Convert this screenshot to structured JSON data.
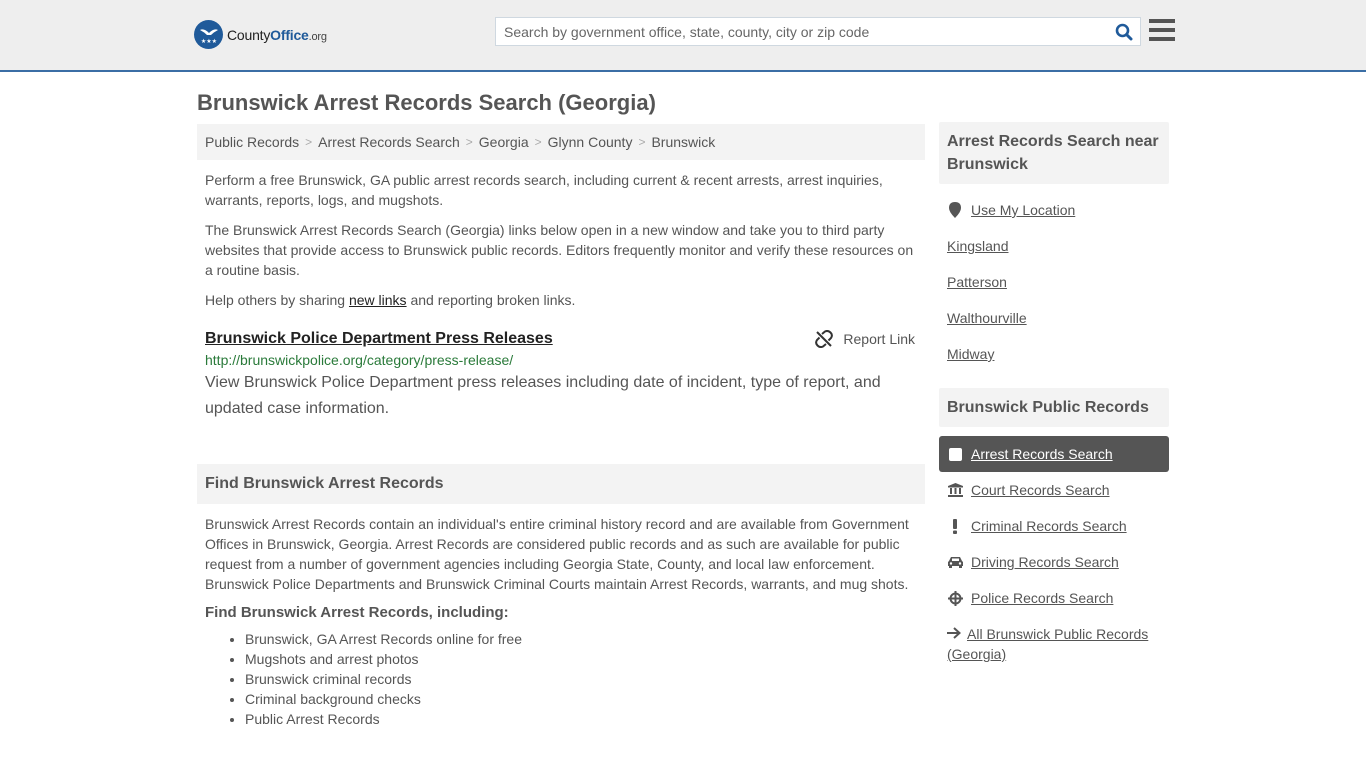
{
  "header": {
    "logo": {
      "county": "County",
      "office": "Office",
      "org": ".org"
    },
    "search_placeholder": "Search by government office, state, county, city or zip code"
  },
  "page_title": "Brunswick Arrest Records Search (Georgia)",
  "breadcrumb": [
    "Public Records",
    "Arrest Records Search",
    "Georgia",
    "Glynn County",
    "Brunswick"
  ],
  "intro": {
    "p1": "Perform a free Brunswick, GA public arrest records search, including current & recent arrests, arrest inquiries, warrants, reports, logs, and mugshots.",
    "p2": "The Brunswick Arrest Records Search (Georgia) links below open in a new window and take you to third party websites that provide access to Brunswick public records. Editors frequently monitor and verify these resources on a routine basis.",
    "p3_before": "Help others by sharing ",
    "p3_link": "new links",
    "p3_after": " and reporting broken links."
  },
  "listing": {
    "title": "Brunswick Police Department Press Releases",
    "report_label": "Report Link",
    "url": "http://brunswickpolice.org/category/press-release/",
    "description": "View Brunswick Police Department press releases including date of incident, type of report, and updated case information."
  },
  "find_section": {
    "heading": "Find Brunswick Arrest Records",
    "body": "Brunswick Arrest Records contain an individual's entire criminal history record and are available from Government Offices in Brunswick, Georgia. Arrest Records are considered public records and as such are available for public request from a number of government agencies including Georgia State, County, and local law enforcement. Brunswick Police Departments and Brunswick Criminal Courts maintain Arrest Records, warrants, and mug shots.",
    "subheading": "Find Brunswick Arrest Records, including:",
    "bullets": [
      "Brunswick, GA Arrest Records online for free",
      "Mugshots and arrest photos",
      "Brunswick criminal records",
      "Criminal background checks",
      "Public Arrest Records"
    ]
  },
  "sidebar": {
    "nearby": {
      "heading": "Arrest Records Search near Brunswick",
      "use_location": "Use My Location",
      "places": [
        "Kingsland",
        "Patterson",
        "Walthourville",
        "Midway"
      ]
    },
    "public_records": {
      "heading": "Brunswick Public Records",
      "items": [
        {
          "label": "Arrest Records Search",
          "icon": "square-icon",
          "active": true
        },
        {
          "label": "Court Records Search",
          "icon": "courthouse-icon"
        },
        {
          "label": "Criminal Records Search",
          "icon": "exclamation-icon"
        },
        {
          "label": "Driving Records Search",
          "icon": "car-icon"
        },
        {
          "label": "Police Records Search",
          "icon": "crosshair-icon"
        },
        {
          "label": "All Brunswick Public Records (Georgia)",
          "icon": "arrow-right-icon"
        }
      ]
    }
  },
  "colors": {
    "brand": "#1f5a9a",
    "url_green": "#2a7a3a",
    "active_bg": "#555555"
  }
}
